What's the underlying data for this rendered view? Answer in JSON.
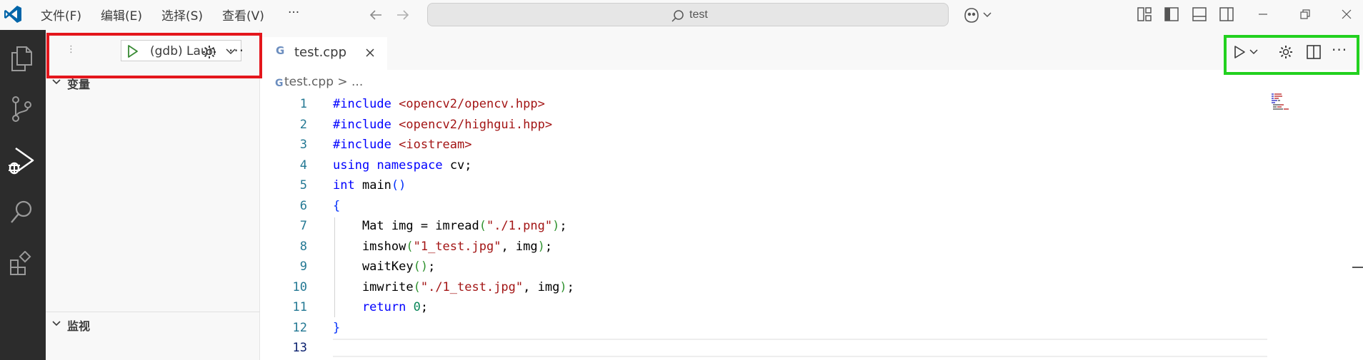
{
  "titlebar": {
    "menu": [
      "文件(F)",
      "编辑(E)",
      "选择(S)",
      "查看(V)",
      "···"
    ],
    "search_text": "test"
  },
  "sidebar": {
    "launch_config": "(gdb) Laun",
    "sections": {
      "variables": "变量",
      "watch": "监视"
    }
  },
  "editor": {
    "tab_label": "test.cpp",
    "breadcrumb": "test.cpp > ...",
    "line_numbers": [
      "1",
      "2",
      "3",
      "4",
      "5",
      "6",
      "7",
      "8",
      "9",
      "10",
      "11",
      "12",
      "13"
    ],
    "code": {
      "l1_kw": "#include",
      "l1_rest": "<opencv2/opencv.hpp>",
      "l2_kw": "#include",
      "l2_rest": "<opencv2/highgui.hpp>",
      "l3_kw": "#include",
      "l3_rest": "<iostream>",
      "l4_kw1": "using",
      "l4_kw2": "namespace",
      "l4_rest": "cv;",
      "l5_kw": "int",
      "l5_name": "main",
      "l5_parens": "()",
      "l6": "{",
      "l7_a": "    Mat img = imread",
      "l7_p1": "(",
      "l7_str": "\"./1.png\"",
      "l7_p2": ")",
      "l7_end": ";",
      "l8_a": "    imshow",
      "l8_p1": "(",
      "l8_str": "\"1_test.jpg\"",
      "l8_b": ", img",
      "l8_p2": ")",
      "l8_end": ";",
      "l9_a": "    waitKey",
      "l9_p": "()",
      "l9_end": ";",
      "l10_a": "    imwrite",
      "l10_p1": "(",
      "l10_str": "\"./1_test.jpg\"",
      "l10_b": ", img",
      "l10_p2": ")",
      "l10_end": ";",
      "l11_kw": "    return",
      "l11_num": "0",
      "l11_end": ";",
      "l12": "}"
    }
  },
  "colors": {
    "highlight_red": "#e4161c",
    "highlight_green": "#22d11f",
    "vscode_blue": "#0065a9",
    "activity_bar": "#2c2c2c"
  },
  "icons": [
    "vscode-logo-icon",
    "arrow-left-icon",
    "arrow-right-icon",
    "search-icon",
    "copilot-icon",
    "layout-icon",
    "toggle-sidebar-icon",
    "toggle-panel-icon",
    "toggle-secondary-sidebar-icon",
    "minimize-icon",
    "restore-icon",
    "close-icon",
    "explorer-icon",
    "source-control-icon",
    "run-debug-icon",
    "search-view-icon",
    "extensions-icon",
    "start-debug-icon",
    "gear-icon",
    "more-icon",
    "cpp-file-icon",
    "tab-close-icon",
    "run-icon",
    "split-editor-icon"
  ]
}
